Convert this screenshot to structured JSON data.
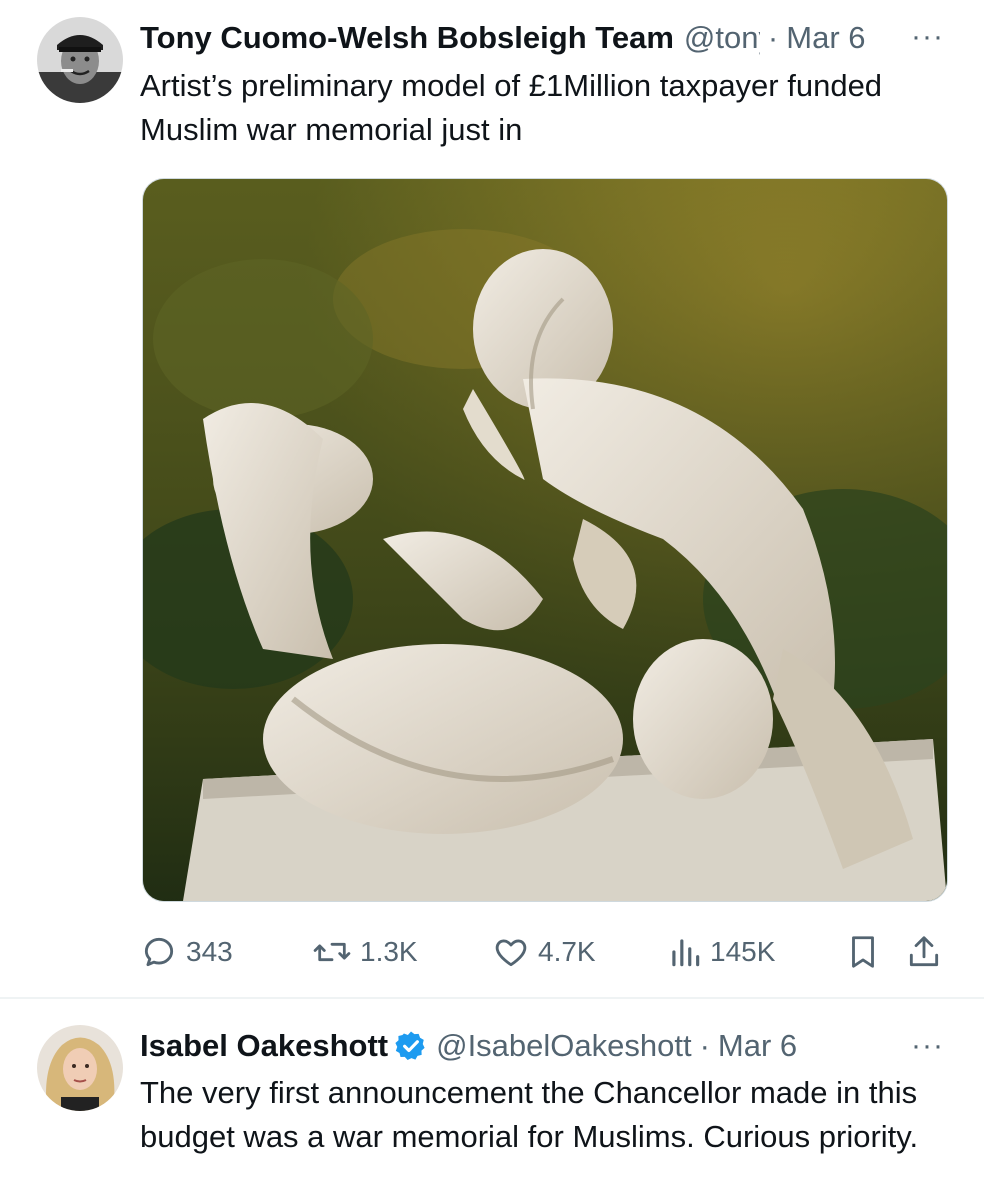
{
  "tweets": [
    {
      "author_name": "Tony Cuomo-Welsh Bobsleigh Team",
      "handle": "@tony",
      "separator": "·",
      "date": "Mar 6",
      "more": "···",
      "text": "Artist’s preliminary model of £1Million taxpayer funded Muslim war memorial just in",
      "media_icon": "statue-photo",
      "actions": {
        "replies": "343",
        "retweets": "1.3K",
        "likes": "4.7K",
        "views": "145K"
      }
    },
    {
      "author_name": "Isabel Oakeshott",
      "verified": true,
      "handle": "@IsabelOakeshott",
      "separator": "·",
      "date": "Mar 6",
      "more": "···",
      "text": "The very first announcement the Chancellor made in this budget was a war memorial for Muslims. Curious priority."
    }
  ],
  "colors": {
    "text_primary": "#0f1419",
    "text_secondary": "#536471",
    "verified_blue": "#1d9bf0",
    "divider": "#eff3f4"
  },
  "icons": [
    "reply-icon",
    "retweet-icon",
    "like-icon",
    "views-icon",
    "bookmark-icon",
    "share-icon",
    "verified-badge-icon",
    "more-icon"
  ]
}
